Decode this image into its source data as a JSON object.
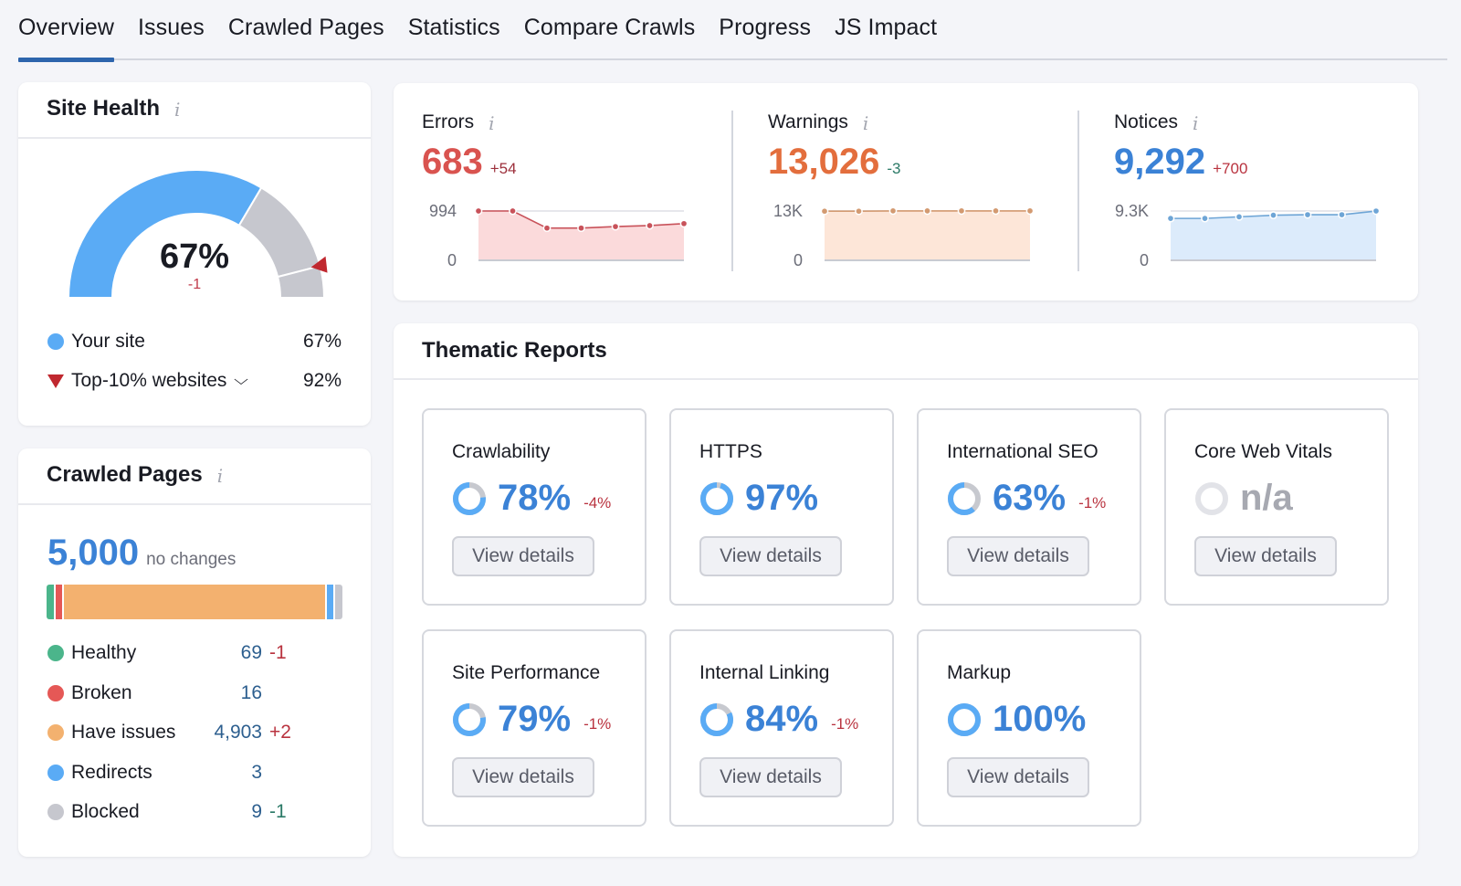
{
  "tabs": [
    {
      "label": "Overview",
      "active": true
    },
    {
      "label": "Issues"
    },
    {
      "label": "Crawled Pages"
    },
    {
      "label": "Statistics"
    },
    {
      "label": "Compare Crawls"
    },
    {
      "label": "Progress"
    },
    {
      "label": "JS Impact"
    }
  ],
  "site_health": {
    "title": "Site Health",
    "info_icon": "i",
    "score": "67%",
    "score_value": 67,
    "top10_value": 92,
    "delta": "-1",
    "legend": [
      {
        "label": "Your site",
        "value": "67%",
        "color": "#5aabf5"
      },
      {
        "label": "Top-10% websites",
        "value": "92%",
        "color": "#c0282f",
        "chevron": "⌄"
      }
    ]
  },
  "crawled_pages": {
    "title": "Crawled Pages",
    "info_icon": "i",
    "total": "5,000",
    "total_note": "no changes",
    "rows": [
      {
        "label": "Healthy",
        "value": "69",
        "delta": "-1",
        "delta_tone": "red",
        "color": "#4bb58b",
        "count": 69
      },
      {
        "label": "Broken",
        "value": "16",
        "delta": "",
        "color": "#e55856",
        "count": 16
      },
      {
        "label": "Have issues",
        "value": "4,903",
        "delta": "+2",
        "delta_tone": "red",
        "color": "#f3b16f",
        "count": 4903
      },
      {
        "label": "Redirects",
        "value": "3",
        "delta": "",
        "color": "#5aabf5",
        "count": 3
      },
      {
        "label": "Blocked",
        "value": "9",
        "delta": "-1",
        "delta_tone": "green",
        "color": "#c6c7ce",
        "count": 9
      }
    ]
  },
  "issues": [
    {
      "title": "Errors",
      "value": "683",
      "delta": "+54",
      "color": "#d9534f",
      "delta_color": "#9c2f3b",
      "fill": "#fbdadb",
      "line": "#c8525a",
      "ymax_label": "994",
      "ymin_label": "0",
      "ymax": 994,
      "series": [
        994,
        994,
        650,
        650,
        680,
        700,
        740
      ]
    },
    {
      "title": "Warnings",
      "value": "13,026",
      "delta": "-3",
      "color": "#e36e3d",
      "delta_color": "#2b7a67",
      "fill": "#fde6d8",
      "line": "#d39a71",
      "ymax_label": "13K",
      "ymin_label": "0",
      "ymax": 13000,
      "series": [
        12950,
        12950,
        13026,
        13026,
        13026,
        13026,
        13026
      ]
    },
    {
      "title": "Notices",
      "value": "9,292",
      "delta": "+700",
      "color": "#3b82d6",
      "delta_color": "#b9333f",
      "fill": "#dcebfb",
      "line": "#6ea5d6",
      "ymax_label": "9.3K",
      "ymin_label": "0",
      "ymax": 9300,
      "series": [
        7900,
        7900,
        8200,
        8500,
        8600,
        8600,
        9292
      ]
    }
  ],
  "thematic": {
    "title": "Thematic Reports",
    "reports": [
      {
        "name": "Crawlability",
        "pct": "78%",
        "value": 78,
        "delta": "-4%",
        "button": "View details"
      },
      {
        "name": "HTTPS",
        "pct": "97%",
        "value": 97,
        "delta": "",
        "button": "View details"
      },
      {
        "name": "International SEO",
        "pct": "63%",
        "value": 63,
        "delta": "-1%",
        "button": "View details"
      },
      {
        "name": "Core Web Vitals",
        "pct": "n/a",
        "value": null,
        "delta": "",
        "button": "View details"
      },
      {
        "name": "Site Performance",
        "pct": "79%",
        "value": 79,
        "delta": "-1%",
        "button": "View details"
      },
      {
        "name": "Internal Linking",
        "pct": "84%",
        "value": 84,
        "delta": "-1%",
        "button": "View details"
      },
      {
        "name": "Markup",
        "pct": "100%",
        "value": 100,
        "delta": "",
        "button": "View details"
      }
    ]
  }
}
